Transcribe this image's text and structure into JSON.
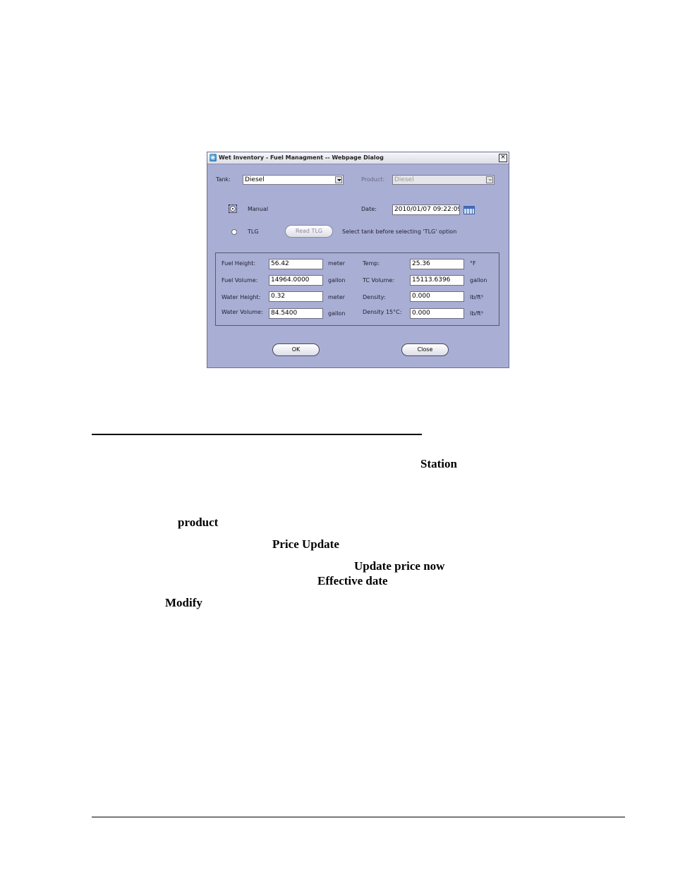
{
  "dialog": {
    "title": "Wet Inventory - Fuel Managment -- Webpage Dialog",
    "tank_label": "Tank:",
    "tank_value": "Diesel",
    "product_label": "Product:",
    "product_value": "Diesel",
    "manual_label": "Manual",
    "tlg_label": "TLG",
    "date_label": "Date:",
    "date_value": "2010/01/07  09:22:09",
    "read_tlg_label": "Read TLG",
    "tlg_hint": "Select tank before selecting 'TLG' option",
    "fields": {
      "fuel_height": {
        "label": "Fuel Height:",
        "value": "56.42",
        "unit": "meter"
      },
      "fuel_volume": {
        "label": "Fuel Volume:",
        "value": "14964.0000",
        "unit": "gallon"
      },
      "water_height": {
        "label": "Water Height:",
        "value": "0.32",
        "unit": "meter"
      },
      "water_volume": {
        "label": "Water Volume:",
        "value": "84.5400",
        "unit": "gallon"
      },
      "temp": {
        "label": "Temp:",
        "value": "25.36",
        "unit": "°F"
      },
      "tc_volume": {
        "label": "TC Volume:",
        "value": "15113.6396",
        "unit": "gallon"
      },
      "density": {
        "label": "Density:",
        "value": "0.000",
        "unit": "lb/ft³"
      },
      "density15": {
        "label": "Density 15°C:",
        "value": "0.000",
        "unit": "lb/ft³"
      }
    },
    "ok_label": "OK",
    "close_label": "Close"
  },
  "doc": {
    "station": "Station",
    "product": "product",
    "price_update": "Price Update",
    "update_price_now": "Update price now",
    "effective_date": "Effective date",
    "modify": "Modify"
  }
}
